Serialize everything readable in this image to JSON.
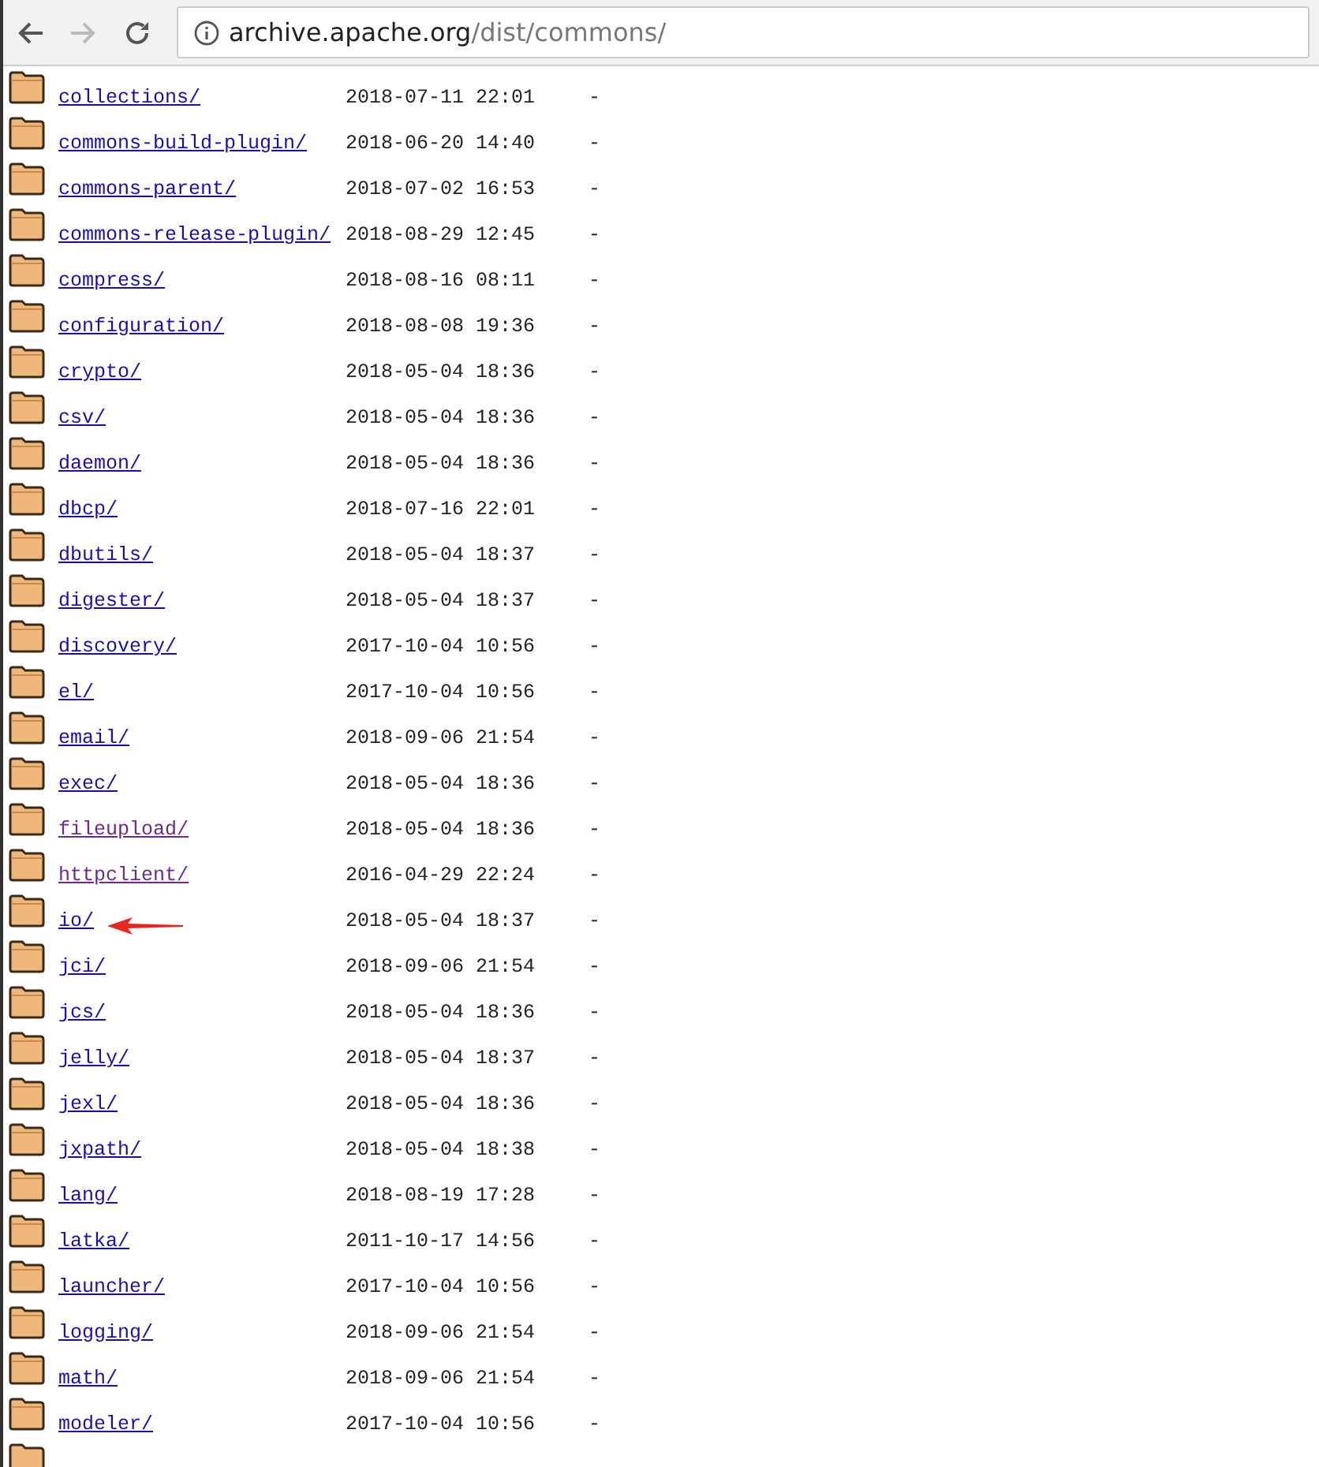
{
  "toolbar": {
    "url_host": "archive.apache.org",
    "url_path": "/dist/commons/"
  },
  "rows": [
    {
      "name": "collections/",
      "modified": "2018-07-11 22:01",
      "size": "-",
      "visited": false,
      "arrow": false
    },
    {
      "name": "commons-build-plugin/",
      "modified": "2018-06-20 14:40",
      "size": "-",
      "visited": false,
      "arrow": false
    },
    {
      "name": "commons-parent/",
      "modified": "2018-07-02 16:53",
      "size": "-",
      "visited": false,
      "arrow": false
    },
    {
      "name": "commons-release-plugin/",
      "modified": "2018-08-29 12:45",
      "size": "-",
      "visited": false,
      "arrow": false
    },
    {
      "name": "compress/",
      "modified": "2018-08-16 08:11",
      "size": "-",
      "visited": false,
      "arrow": false
    },
    {
      "name": "configuration/",
      "modified": "2018-08-08 19:36",
      "size": "-",
      "visited": false,
      "arrow": false
    },
    {
      "name": "crypto/",
      "modified": "2018-05-04 18:36",
      "size": "-",
      "visited": false,
      "arrow": false
    },
    {
      "name": "csv/",
      "modified": "2018-05-04 18:36",
      "size": "-",
      "visited": false,
      "arrow": false
    },
    {
      "name": "daemon/",
      "modified": "2018-05-04 18:36",
      "size": "-",
      "visited": false,
      "arrow": false
    },
    {
      "name": "dbcp/",
      "modified": "2018-07-16 22:01",
      "size": "-",
      "visited": false,
      "arrow": false
    },
    {
      "name": "dbutils/",
      "modified": "2018-05-04 18:37",
      "size": "-",
      "visited": false,
      "arrow": false
    },
    {
      "name": "digester/",
      "modified": "2018-05-04 18:37",
      "size": "-",
      "visited": false,
      "arrow": false
    },
    {
      "name": "discovery/",
      "modified": "2017-10-04 10:56",
      "size": "-",
      "visited": false,
      "arrow": false
    },
    {
      "name": "el/",
      "modified": "2017-10-04 10:56",
      "size": "-",
      "visited": false,
      "arrow": false
    },
    {
      "name": "email/",
      "modified": "2018-09-06 21:54",
      "size": "-",
      "visited": false,
      "arrow": false
    },
    {
      "name": "exec/",
      "modified": "2018-05-04 18:36",
      "size": "-",
      "visited": false,
      "arrow": false
    },
    {
      "name": "fileupload/",
      "modified": "2018-05-04 18:36",
      "size": "-",
      "visited": true,
      "arrow": false
    },
    {
      "name": "httpclient/",
      "modified": "2016-04-29 22:24",
      "size": "-",
      "visited": true,
      "arrow": false
    },
    {
      "name": "io/",
      "modified": "2018-05-04 18:37",
      "size": "-",
      "visited": false,
      "arrow": true
    },
    {
      "name": "jci/",
      "modified": "2018-09-06 21:54",
      "size": "-",
      "visited": false,
      "arrow": false
    },
    {
      "name": "jcs/",
      "modified": "2018-05-04 18:36",
      "size": "-",
      "visited": false,
      "arrow": false
    },
    {
      "name": "jelly/",
      "modified": "2018-05-04 18:37",
      "size": "-",
      "visited": false,
      "arrow": false
    },
    {
      "name": "jexl/",
      "modified": "2018-05-04 18:36",
      "size": "-",
      "visited": false,
      "arrow": false
    },
    {
      "name": "jxpath/",
      "modified": "2018-05-04 18:38",
      "size": "-",
      "visited": false,
      "arrow": false
    },
    {
      "name": "lang/",
      "modified": "2018-08-19 17:28",
      "size": "-",
      "visited": false,
      "arrow": false
    },
    {
      "name": "latka/",
      "modified": "2011-10-17 14:56",
      "size": "-",
      "visited": false,
      "arrow": false
    },
    {
      "name": "launcher/",
      "modified": "2017-10-04 10:56",
      "size": "-",
      "visited": false,
      "arrow": false
    },
    {
      "name": "logging/",
      "modified": "2018-09-06 21:54",
      "size": "-",
      "visited": false,
      "arrow": false
    },
    {
      "name": "math/",
      "modified": "2018-09-06 21:54",
      "size": "-",
      "visited": false,
      "arrow": false
    },
    {
      "name": "modeler/",
      "modified": "2017-10-04 10:56",
      "size": "-",
      "visited": false,
      "arrow": false
    }
  ]
}
